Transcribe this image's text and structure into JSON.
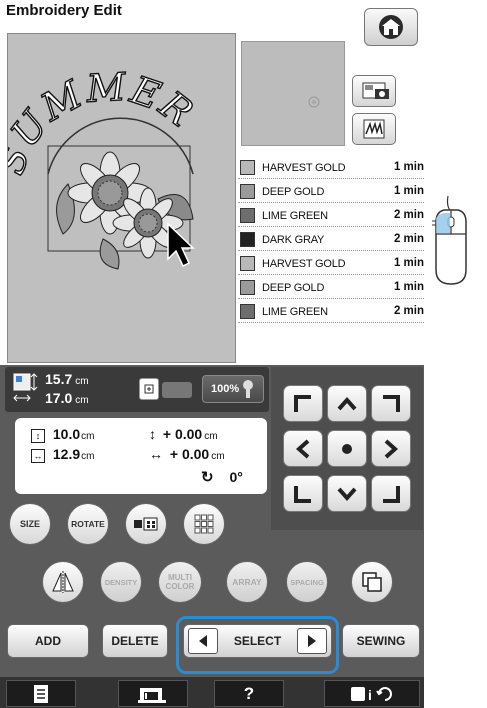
{
  "screen_title": "Embroidery Edit",
  "design_text": "SUMMER",
  "threads": [
    {
      "name": "HARVEST GOLD",
      "time": "1 min",
      "color": "#b8b8b8"
    },
    {
      "name": "DEEP GOLD",
      "time": "1 min",
      "color": "#9a9a9a"
    },
    {
      "name": "LIME GREEN",
      "time": "2 min",
      "color": "#6e6e6e"
    },
    {
      "name": "DARK GRAY",
      "time": "2 min",
      "color": "#222222"
    },
    {
      "name": "HARVEST GOLD",
      "time": "1 min",
      "color": "#b8b8b8"
    },
    {
      "name": "DEEP GOLD",
      "time": "1 min",
      "color": "#9a9a9a"
    },
    {
      "name": "LIME GREEN",
      "time": "2 min",
      "color": "#6e6e6e"
    }
  ],
  "info_bar": {
    "height": "15.7",
    "width": "17.0",
    "unit": "cm",
    "zoom": "100%"
  },
  "info_box": {
    "size_h": "10.0",
    "size_w": "12.9",
    "unit": "cm",
    "offset_v": "+ 0.00",
    "offset_h": "+ 0.00",
    "rotation": "0°"
  },
  "buttons": {
    "size": "SIZE",
    "rotate": "ROTATE",
    "density": "DENSITY",
    "multi_color": "MULTI COLOR",
    "array": "ARRAY",
    "spacing": "SPACING",
    "add": "ADD",
    "delete": "DELETE",
    "select": "SELECT",
    "sewing": "SEWING"
  },
  "bottom_nav": {
    "help": "?"
  },
  "colors": {
    "select_highlight": "#2a8cd3",
    "panel": "#5b5b5b",
    "canvas": "#bfbfbf"
  }
}
